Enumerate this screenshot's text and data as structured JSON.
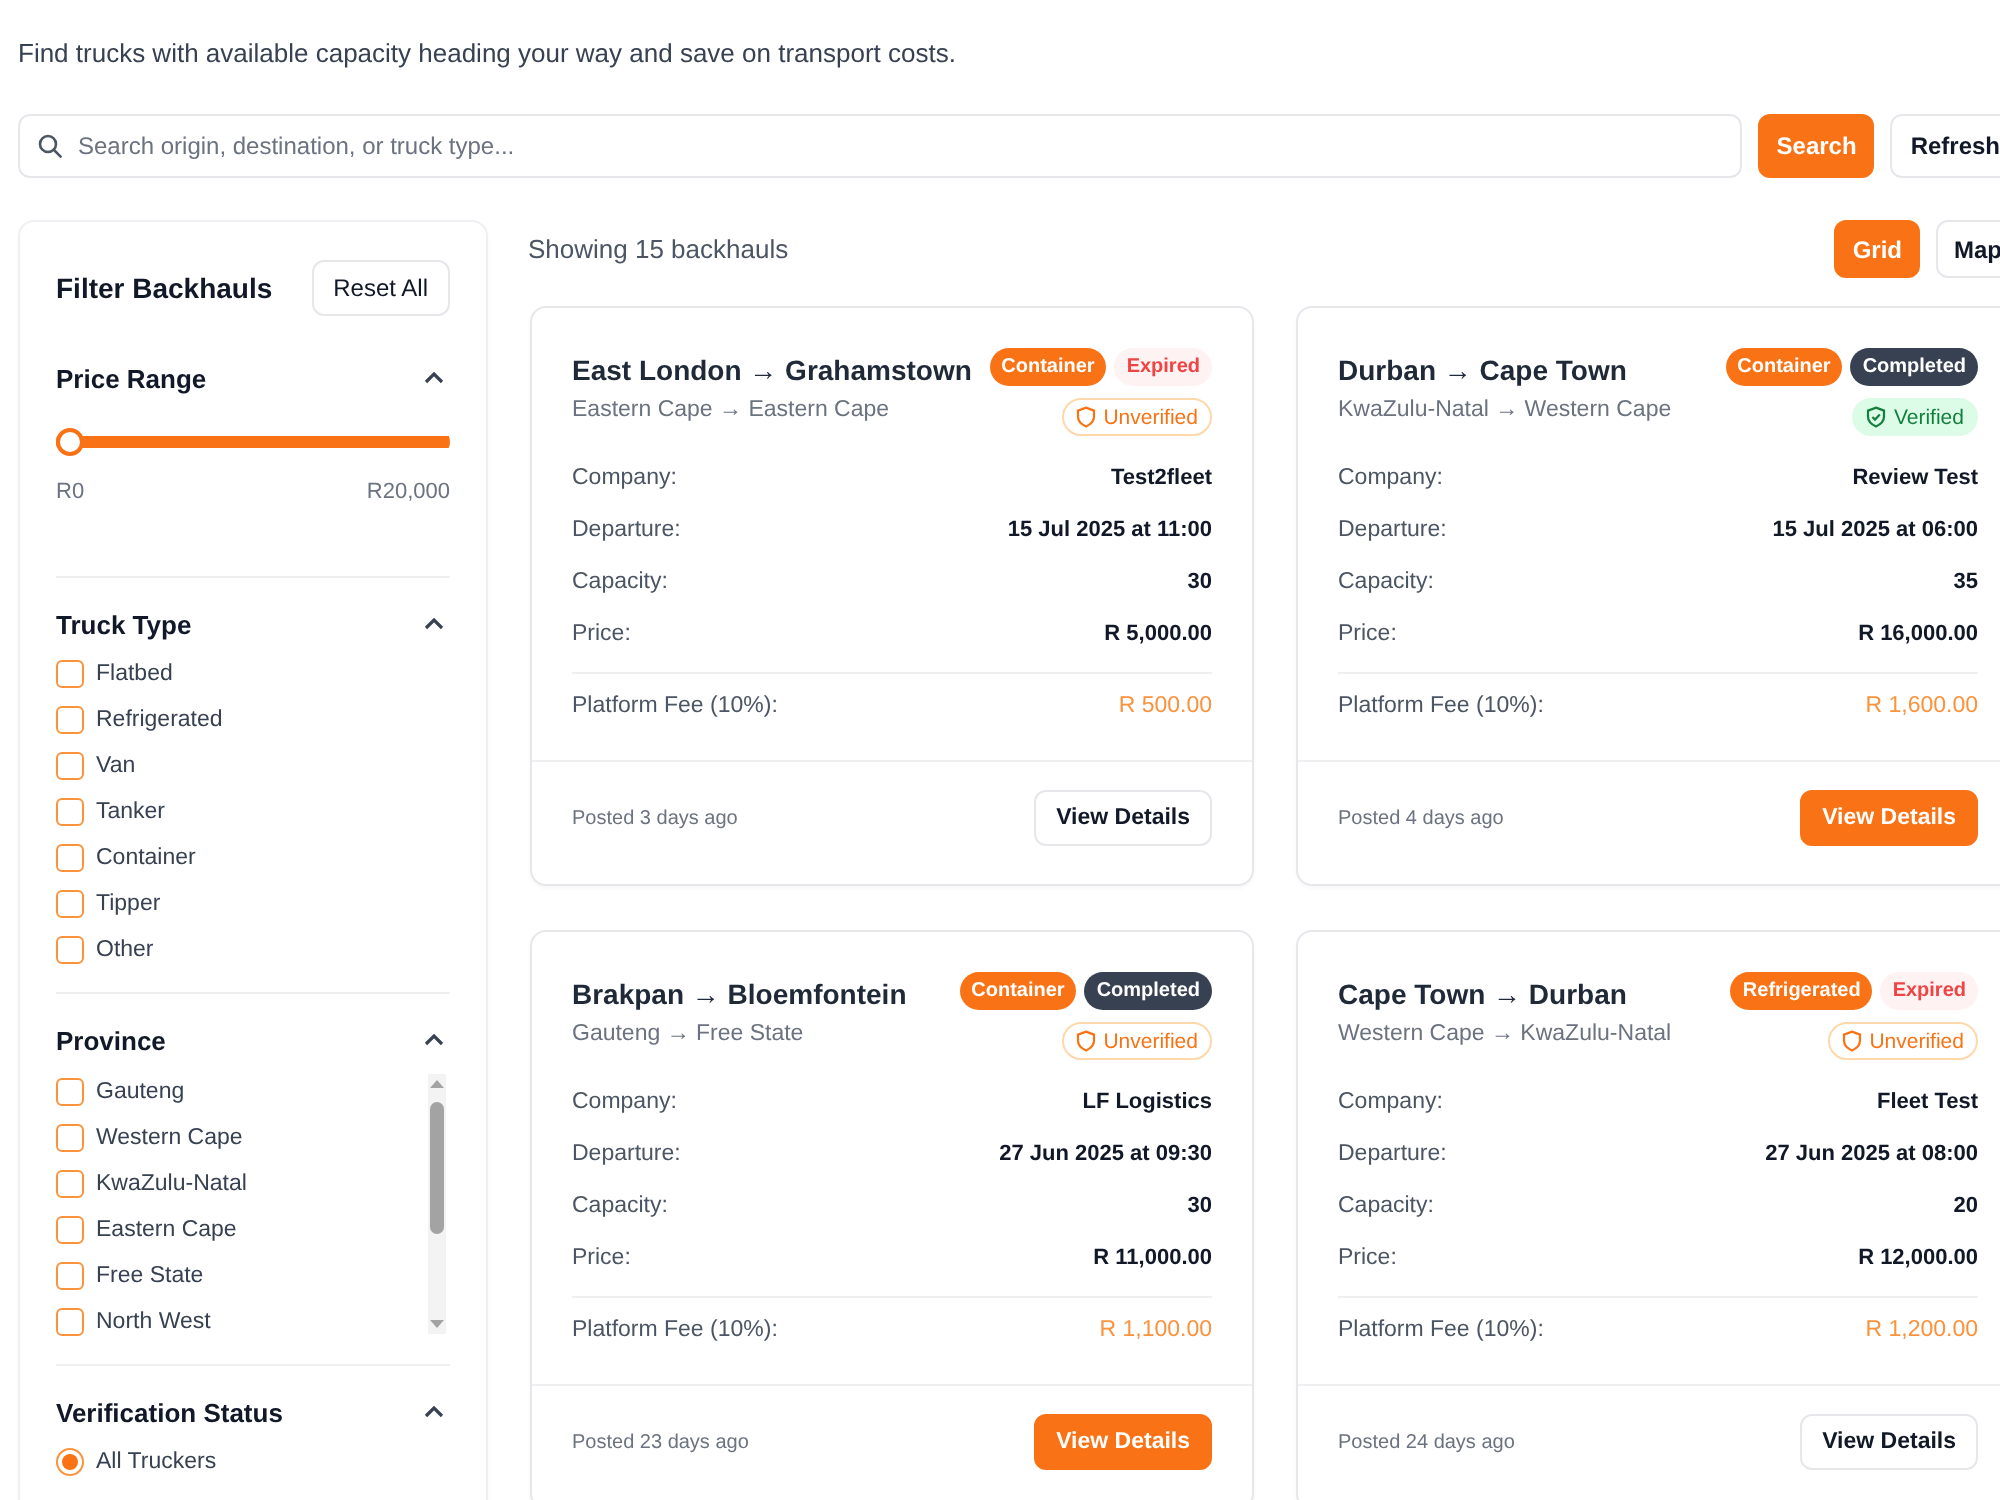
{
  "intro": "Find trucks with available capacity heading your way and save on transport costs.",
  "search": {
    "placeholder": "Search origin, destination, or truck type...",
    "search_button": "Search",
    "refresh_button": "Refresh"
  },
  "sidebar": {
    "title": "Filter Backhauls",
    "reset_button": "Reset All",
    "sections": [
      {
        "kind": "range",
        "title": "Price Range",
        "expanded": true,
        "level": 0,
        "min_label": "R0",
        "max_label": "R20,000"
      },
      {
        "kind": "checkboxes",
        "title": "Truck Type",
        "expanded": true,
        "items": [
          {
            "label": "Flatbed",
            "checked": false
          },
          {
            "label": "Refrigerated",
            "checked": false
          },
          {
            "label": "Van",
            "checked": false
          },
          {
            "label": "Tanker",
            "checked": false
          },
          {
            "label": "Container",
            "checked": false
          },
          {
            "label": "Tipper",
            "checked": false
          },
          {
            "label": "Other",
            "checked": false
          }
        ]
      },
      {
        "kind": "checkboxes",
        "title": "Province",
        "expanded": true,
        "scrollable": true,
        "items": [
          {
            "label": "Gauteng",
            "checked": false
          },
          {
            "label": "Western Cape",
            "checked": false
          },
          {
            "label": "KwaZulu-Natal",
            "checked": false
          },
          {
            "label": "Eastern Cape",
            "checked": false
          },
          {
            "label": "Free State",
            "checked": false
          },
          {
            "label": "North West",
            "checked": false
          }
        ]
      },
      {
        "kind": "radios",
        "title": "Verification Status",
        "expanded": true,
        "items": [
          {
            "label": "All Truckers",
            "selected": true
          }
        ]
      }
    ]
  },
  "results": {
    "count": "Showing 15 backhauls",
    "view_tabs": [
      {
        "label": "Grid",
        "selected": true
      },
      {
        "label": "Map",
        "selected": false
      }
    ],
    "cards": [
      {
        "route": "East London → Grahamstown",
        "provinces": "Eastern Cape → Eastern Cape",
        "tags": [
          {
            "label": "Container",
            "kind": "truck_type"
          },
          {
            "label": "Expired",
            "kind": "expired"
          }
        ],
        "verification": {
          "label": "Unverified",
          "verified": false
        },
        "details": [
          {
            "label": "Company:",
            "value": "Test2fleet"
          },
          {
            "label": "Departure:",
            "value": "15 Jul 2025 at 11:00"
          },
          {
            "label": "Capacity:",
            "value": "30"
          },
          {
            "label": "Price:",
            "value": "R 5,000.00"
          }
        ],
        "fee": {
          "label": "Platform Fee (10%):",
          "value": "R 500.00"
        },
        "posted": "Posted 3 days ago",
        "button": {
          "label": "View Details",
          "kind": "outline"
        }
      },
      {
        "route": "Durban → Cape Town",
        "provinces": "KwaZulu-Natal → Western Cape",
        "tags": [
          {
            "label": "Container",
            "kind": "truck_type"
          },
          {
            "label": "Completed",
            "kind": "completed"
          }
        ],
        "verification": {
          "label": "Verified",
          "verified": true
        },
        "details": [
          {
            "label": "Company:",
            "value": "Review Test"
          },
          {
            "label": "Departure:",
            "value": "15 Jul 2025 at 06:00"
          },
          {
            "label": "Capacity:",
            "value": "35"
          },
          {
            "label": "Price:",
            "value": "R 16,000.00"
          }
        ],
        "fee": {
          "label": "Platform Fee (10%):",
          "value": "R 1,600.00"
        },
        "posted": "Posted 4 days ago",
        "button": {
          "label": "View Details",
          "kind": "filled"
        }
      },
      {
        "route": "Brakpan → Bloemfontein",
        "provinces": "Gauteng → Free State",
        "tags": [
          {
            "label": "Container",
            "kind": "truck_type"
          },
          {
            "label": "Completed",
            "kind": "completed"
          }
        ],
        "verification": {
          "label": "Unverified",
          "verified": false
        },
        "details": [
          {
            "label": "Company:",
            "value": "LF Logistics"
          },
          {
            "label": "Departure:",
            "value": "27 Jun 2025 at 09:30"
          },
          {
            "label": "Capacity:",
            "value": "30"
          },
          {
            "label": "Price:",
            "value": "R 11,000.00"
          }
        ],
        "fee": {
          "label": "Platform Fee (10%):",
          "value": "R 1,100.00"
        },
        "posted": "Posted 23 days ago",
        "button": {
          "label": "View Details",
          "kind": "filled"
        }
      },
      {
        "route": "Cape Town → Durban",
        "provinces": "Western Cape → KwaZulu-Natal",
        "tags": [
          {
            "label": "Refrigerated",
            "kind": "truck_type"
          },
          {
            "label": "Expired",
            "kind": "expired"
          }
        ],
        "verification": {
          "label": "Unverified",
          "verified": false
        },
        "details": [
          {
            "label": "Company:",
            "value": "Fleet Test"
          },
          {
            "label": "Departure:",
            "value": "27 Jun 2025 at 08:00"
          },
          {
            "label": "Capacity:",
            "value": "20"
          },
          {
            "label": "Price:",
            "value": "R 12,000.00"
          }
        ],
        "fee": {
          "label": "Platform Fee (10%):",
          "value": "R 1,200.00"
        },
        "posted": "Posted 24 days ago",
        "button": {
          "label": "View Details",
          "kind": "outline"
        }
      }
    ]
  }
}
